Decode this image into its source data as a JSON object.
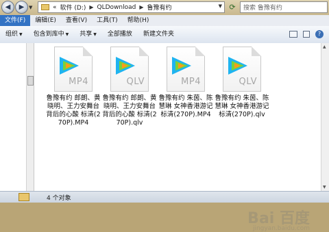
{
  "address_bar": {
    "prefix": "«",
    "path": [
      "软件 (D:)",
      "QLDownload",
      "鲁豫有约"
    ],
    "search_placeholder": "搜索 鲁豫有约"
  },
  "menu": [
    "文件(F)",
    "编辑(E)",
    "查看(V)",
    "工具(T)",
    "帮助(H)"
  ],
  "toolbar": {
    "organize": "组织",
    "include_in_library": "包含到库中",
    "share": "共享",
    "play_all": "全部播放",
    "new_folder": "新建文件夹"
  },
  "files": [
    {
      "name": "鲁豫有约 郎朗、黄晓明、王力安舞台背后的心酸 标清(270P).MP4",
      "ext": "MP4"
    },
    {
      "name": "鲁豫有约 郎朗、黄晓明、王力安舞台背后的心酸 标清(270P).qlv",
      "ext": "QLV"
    },
    {
      "name": "鲁豫有约 朱茵、陈慧琳 女神香港游记 标清(270P).MP4",
      "ext": "MP4"
    },
    {
      "name": "鲁豫有约 朱茵、陈慧琳 女神香港游记 标清(270P).qlv",
      "ext": "QLV"
    }
  ],
  "status": {
    "count_text": "4 个对象"
  },
  "watermark": {
    "brand": "Bai 百度",
    "sub": "jingyan.baidu.com"
  },
  "icons": {
    "back": "back-arrow-icon",
    "forward": "forward-arrow-icon",
    "refresh": "refresh-icon",
    "search": "search-icon",
    "logo": "tencent-video-logo-icon"
  }
}
